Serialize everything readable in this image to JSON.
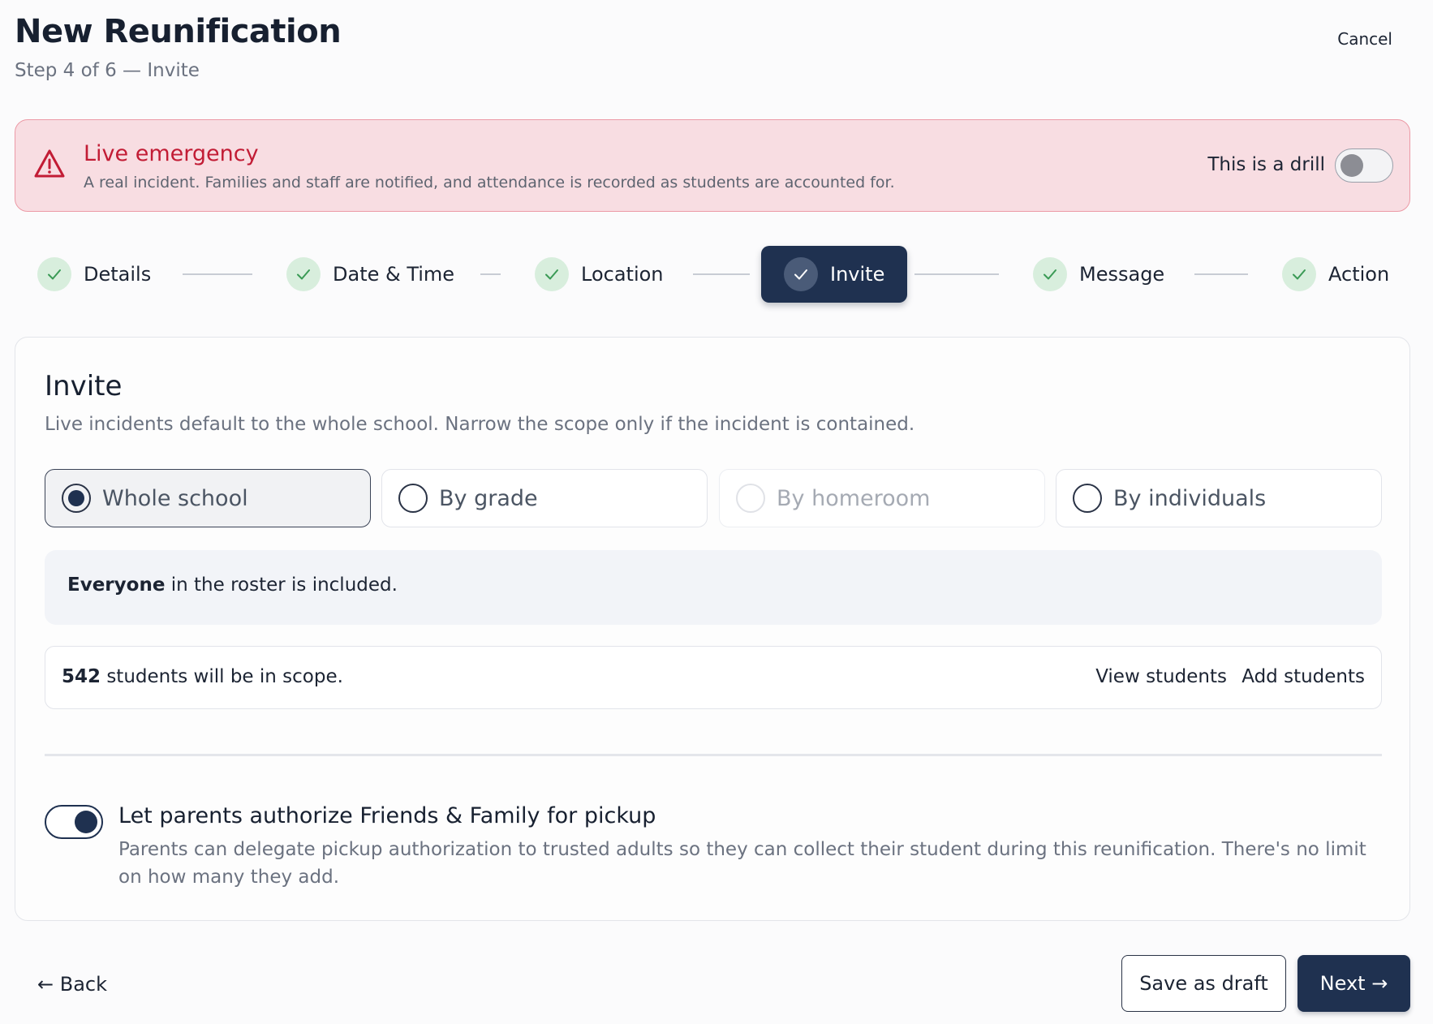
{
  "header": {
    "title": "New Reunification",
    "subtitle": "Step 4 of 6 — Invite",
    "cancel_label": "Cancel"
  },
  "banner": {
    "title": "Live emergency",
    "text": "A real incident. Families and staff are notified, and attendance is recorded as students are accounted for.",
    "drill_label": "This is a drill",
    "drill_on": false,
    "icon": "warning-triangle-icon"
  },
  "stepper": {
    "steps": [
      {
        "label": "Details",
        "done": true,
        "active": false
      },
      {
        "label": "Date & Time",
        "done": true,
        "active": false
      },
      {
        "label": "Location",
        "done": true,
        "active": false
      },
      {
        "label": "Invite",
        "done": true,
        "active": true
      },
      {
        "label": "Message",
        "done": true,
        "active": false
      },
      {
        "label": "Action",
        "done": true,
        "active": false
      }
    ]
  },
  "invite": {
    "title": "Invite",
    "description": "Live incidents default to the whole school. Narrow the scope only if the incident is contained.",
    "options": [
      {
        "label": "Whole school",
        "selected": true,
        "disabled": false
      },
      {
        "label": "By grade",
        "selected": false,
        "disabled": false
      },
      {
        "label": "By homeroom",
        "selected": false,
        "disabled": true
      },
      {
        "label": "By individuals",
        "selected": false,
        "disabled": false
      }
    ],
    "info_bold": "Everyone",
    "info_rest": " in the roster is included.",
    "scope_count": "542",
    "scope_rest": " students will be in scope.",
    "view_students": "View students",
    "add_students": "Add students",
    "pickup_title": "Let parents authorize Friends & Family for pickup",
    "pickup_desc": "Parents can delegate pickup authorization to trusted adults so they can collect their student during this reunification. There's no limit on how many they add.",
    "pickup_on": true
  },
  "footer": {
    "back_label": "← Back",
    "save_draft_label": "Save as draft",
    "next_label": "Next →"
  },
  "colors": {
    "primary": "#1f3150",
    "danger": "#c21c35",
    "banner_bg": "#f8dde2",
    "check_bg": "#d8eedd",
    "check_color": "#3a9a55"
  }
}
